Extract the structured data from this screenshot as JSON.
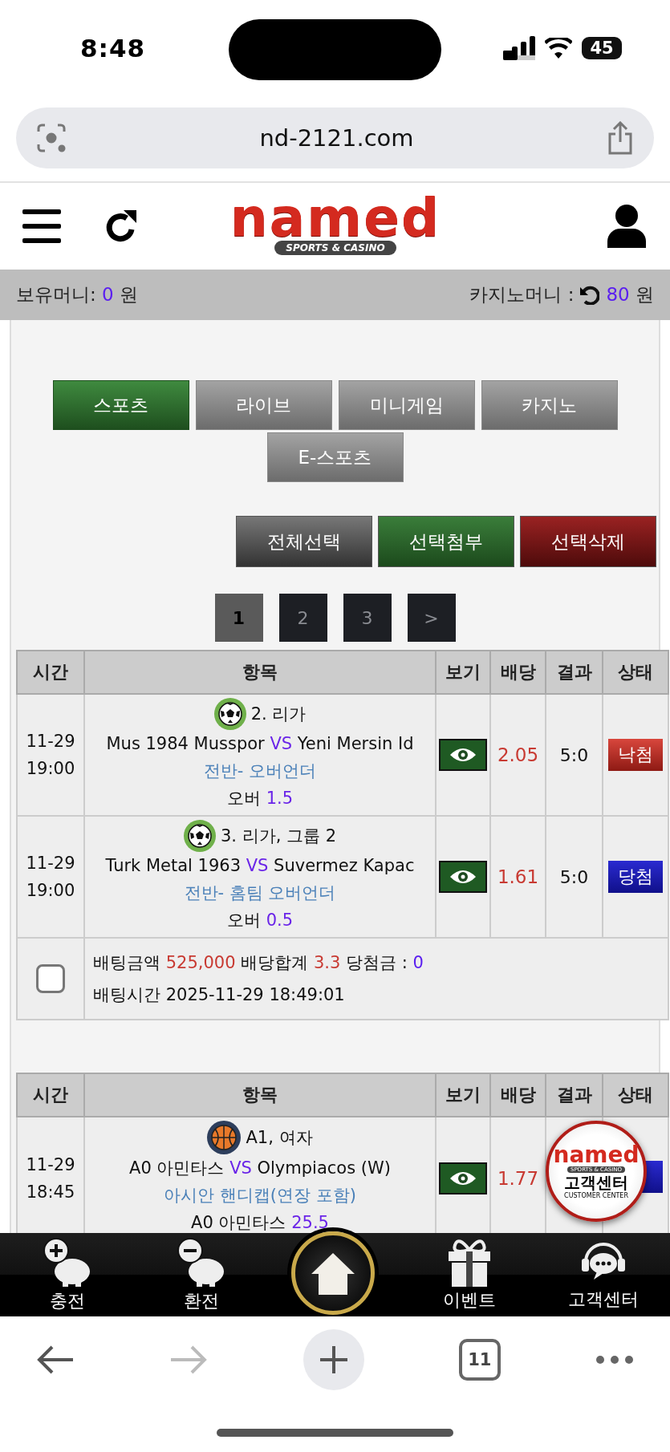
{
  "status_bar": {
    "time": "8:48",
    "battery": "45"
  },
  "browser": {
    "url": "nd-2121.com",
    "tab_count": "11"
  },
  "header": {
    "logo": "named",
    "logo_tagline": "SPORTS & CASINO"
  },
  "balance": {
    "label": "보유머니:",
    "amount": "0",
    "unit": "원",
    "casino_label": "카지노머니 :",
    "casino_amount": "80",
    "casino_unit": "원"
  },
  "category_tabs": [
    {
      "label": "스포츠",
      "selected": true
    },
    {
      "label": "라이브",
      "selected": false
    },
    {
      "label": "미니게임",
      "selected": false
    },
    {
      "label": "카지노",
      "selected": false
    },
    {
      "label": "E-스포츠",
      "selected": false
    }
  ],
  "actions": [
    {
      "label": "전체선택",
      "kind": "select_all"
    },
    {
      "label": "선택첨부",
      "kind": "attach"
    },
    {
      "label": "선택삭제",
      "kind": "delete"
    }
  ],
  "pagination": [
    {
      "label": "1",
      "selected": true
    },
    {
      "label": "2",
      "selected": false
    },
    {
      "label": "3",
      "selected": false
    },
    {
      "label": ">",
      "selected": false
    }
  ],
  "bet_slips": [
    {
      "columns": [
        "시간",
        "항목",
        "보기",
        "배당",
        "결과",
        "상태"
      ],
      "rows": [
        {
          "datetime": "11-29 19:00",
          "kind": "soccer",
          "league": "2. 리가",
          "home": "Mus 1984 Musspor",
          "vs": "VS",
          "away": "Yeni Mersin Id",
          "market": "전반- 오버언더",
          "pick": "오버",
          "line": "1.5",
          "odds": "2.05",
          "result": "5:0",
          "status": {
            "label": "낙첨",
            "kind": "lose"
          }
        },
        {
          "datetime": "11-29 19:00",
          "kind": "soccer",
          "league": "3. 리가, 그룹 2",
          "home": "Turk Metal 1963",
          "vs": "VS",
          "away": "Suvermez Kapac",
          "market": "전반- 홈팀 오버언더",
          "pick": "오버",
          "line": "0.5",
          "odds": "1.61",
          "result": "5:0",
          "status": {
            "label": "당첨",
            "kind": "win"
          }
        }
      ],
      "summary": {
        "checked": false,
        "amount_label": "배팅금액",
        "amount": "525,000",
        "odds_label": "배당합계",
        "odds": "3.3",
        "win_label": "당첨금 :",
        "win": "0",
        "time_label": "배팅시간",
        "time": "2025-11-29 18:49:01"
      }
    },
    {
      "columns": [
        "시간",
        "항목",
        "보기",
        "배당",
        "결과",
        "상태"
      ],
      "rows": [
        {
          "datetime": "11-29 18:45",
          "kind": "basketball",
          "league": "A1, 여자",
          "home": "A0 아민타스",
          "vs": "VS",
          "away": "Olympiacos (W)",
          "market": "아시안 핸디캡(연장 포함)",
          "pick": "A0 아민타스",
          "line": "25.5",
          "odds": "1.77",
          "status": {
            "kind": "win"
          }
        }
      ]
    }
  ],
  "customer_center_badge": {
    "logo": "named",
    "tagline": "SPORTS & CASINO",
    "label": "고객센터",
    "sublabel": "CUSTOMER CENTER"
  },
  "bottom_nav": [
    {
      "label": "충전",
      "kind": "deposit"
    },
    {
      "label": "환전",
      "kind": "withdraw"
    },
    {
      "kind": "home"
    },
    {
      "label": "이벤트",
      "kind": "event"
    },
    {
      "label": "고객센터",
      "kind": "support"
    }
  ]
}
